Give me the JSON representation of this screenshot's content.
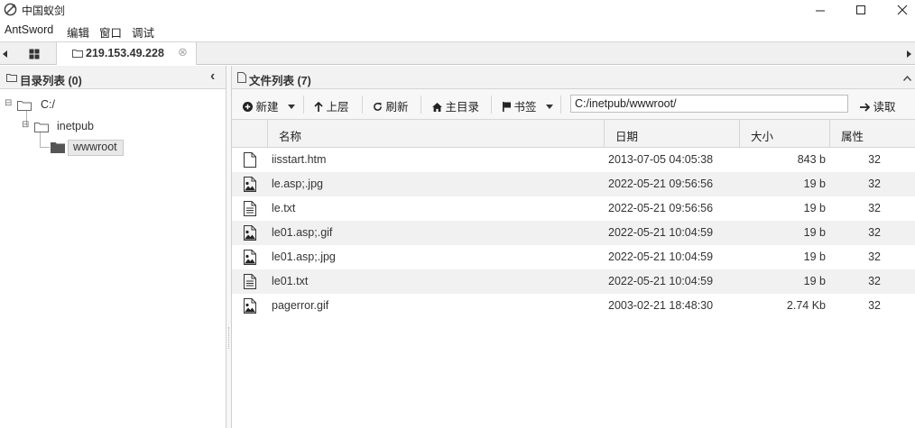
{
  "window": {
    "title": "中国蚁剑",
    "minimize_glyph": "─",
    "maximize_glyph": "☐",
    "close_glyph": "✕"
  },
  "menu": [
    "AntSword",
    "编辑",
    "窗口",
    "调试"
  ],
  "tabs": {
    "active_label": "219.153.49.228",
    "close_glyph": "⊗"
  },
  "tree_panel": {
    "title": "目录列表 (0)",
    "collapse_glyph": "‹",
    "nodes": [
      {
        "label": "C:/",
        "expander": "⊟"
      },
      {
        "label": "inetpub",
        "expander": "⊟"
      },
      {
        "label": "wwwroot",
        "expander": ""
      }
    ]
  },
  "file_panel": {
    "title": "文件列表 (7)",
    "toolbar": {
      "new_label": "新建",
      "up_label": "上层",
      "refresh_label": "刷新",
      "home_label": "主目录",
      "bookmark_label": "书签",
      "path_value": "C:/inetpub/wwwroot/",
      "read_label": "读取"
    },
    "columns": [
      "名称",
      "日期",
      "大小",
      "属性"
    ],
    "files": [
      {
        "name": "iisstart.htm",
        "date": "2013-07-05 04:05:38",
        "size": "843 b",
        "attr": "32",
        "icon": "file-icon"
      },
      {
        "name": "le.asp;.jpg",
        "date": "2022-05-21 09:56:56",
        "size": "19 b",
        "attr": "32",
        "icon": "image-file-icon"
      },
      {
        "name": "le.txt",
        "date": "2022-05-21 09:56:56",
        "size": "19 b",
        "attr": "32",
        "icon": "text-file-icon"
      },
      {
        "name": "le01.asp;.gif",
        "date": "2022-05-21 10:04:59",
        "size": "19 b",
        "attr": "32",
        "icon": "image-file-icon"
      },
      {
        "name": "le01.asp;.jpg",
        "date": "2022-05-21 10:04:59",
        "size": "19 b",
        "attr": "32",
        "icon": "image-file-icon"
      },
      {
        "name": "le01.txt",
        "date": "2022-05-21 10:04:59",
        "size": "19 b",
        "attr": "32",
        "icon": "text-file-icon"
      },
      {
        "name": "pagerror.gif",
        "date": "2003-02-21 18:48:30",
        "size": "2.74 Kb",
        "attr": "32",
        "icon": "image-file-icon"
      }
    ]
  },
  "colors": {
    "row_alt": "#f1f1f1",
    "header_bg": "#f2f2f2",
    "border": "#d5d5d5",
    "selected_node": "#e8e8e8"
  }
}
